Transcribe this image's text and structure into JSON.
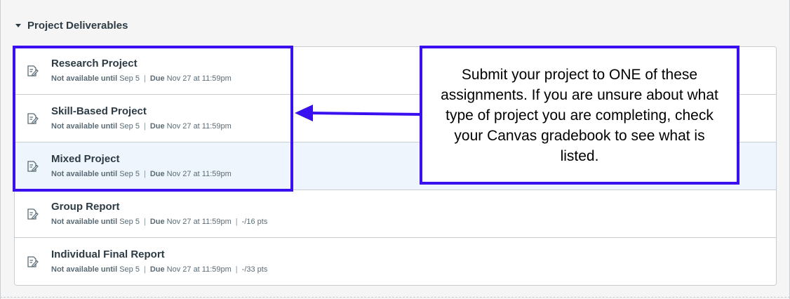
{
  "module": {
    "title": "Project Deliverables"
  },
  "items": [
    {
      "title": "Research Project",
      "na_label": "Not available until",
      "na_date": "Sep 5",
      "due_label": "Due",
      "due_date": "Nov 27 at 11:59pm",
      "points": ""
    },
    {
      "title": "Skill-Based Project",
      "na_label": "Not available until",
      "na_date": "Sep 5",
      "due_label": "Due",
      "due_date": "Nov 27 at 11:59pm",
      "points": ""
    },
    {
      "title": "Mixed Project",
      "na_label": "Not available until",
      "na_date": "Sep 5",
      "due_label": "Due",
      "due_date": "Nov 27 at 11:59pm",
      "points": ""
    },
    {
      "title": "Group Report",
      "na_label": "Not available until",
      "na_date": "Sep 5",
      "due_label": "Due",
      "due_date": "Nov 27 at 11:59pm",
      "points": "-/16 pts"
    },
    {
      "title": "Individual Final Report",
      "na_label": "Not available until",
      "na_date": "Sep 5",
      "due_label": "Due",
      "due_date": "Nov 27 at 11:59pm",
      "points": "-/33 pts"
    }
  ],
  "annotation": {
    "text": "Submit your project to ONE of these assignments. If you are unsure about what type of project you are completing, check your Canvas gradebook to see what is listed."
  },
  "colors": {
    "annotation_border": "#3a0ff0",
    "highlight_row": "#eef5fc",
    "text": "#2d3b45",
    "meta_text": "#5b6b75"
  },
  "icons": {
    "caret": "caret-down-icon",
    "assignment": "assignment-icon",
    "arrow": "arrow-left-icon"
  }
}
